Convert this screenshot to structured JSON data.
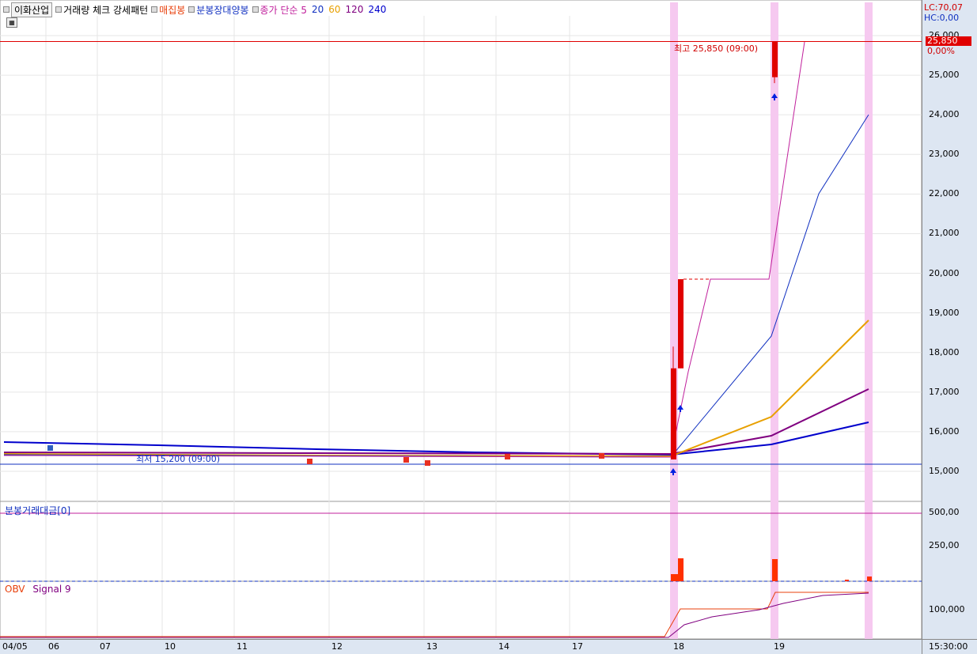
{
  "legend": {
    "stock_name": "이화산업",
    "indicator_1": "거래량 체크 강세패턴",
    "indicator_2": "매집봉",
    "indicator_3": "분봉장대양봉",
    "ma_label": "종가 단순 5",
    "ma_20": "20",
    "ma_60": "60",
    "ma_120": "120",
    "ma_240": "240",
    "colors": {
      "indicator_2": "#e8400c",
      "indicator_3": "#1030c0",
      "ma_5": "#c0209c",
      "ma_20": "#1030c0",
      "ma_60": "#e8a000",
      "ma_120": "#800080",
      "ma_240": "#0000cc"
    }
  },
  "price_axis": {
    "lc": "LC:70,07",
    "hc": "HC:0,00",
    "ticks": [
      "26,000",
      "25,000",
      "24,000",
      "23,000",
      "22,000",
      "21,000",
      "20,000",
      "19,000",
      "18,000",
      "17,000",
      "16,000",
      "15,000"
    ],
    "current_price": "25,850",
    "current_change": "0,00%"
  },
  "annotations": {
    "high": "최고 25,850 (09:00)",
    "low": "최저 15,200 (09:00)"
  },
  "volume_panel": {
    "label": "분봉거래대금[0]",
    "ticks": [
      "500,00",
      "250,00"
    ]
  },
  "obv_panel": {
    "label_obv": "OBV",
    "label_signal": "Signal 9",
    "ticks": [
      "100,000"
    ]
  },
  "date_axis": {
    "dates": [
      "04/05",
      "06",
      "07",
      "10",
      "11",
      "12",
      "13",
      "14",
      "17",
      "18",
      "19"
    ],
    "time": "15:30:00"
  },
  "chart_data": {
    "type": "candlestick",
    "price_range": [
      14600,
      26200
    ],
    "high": 25850,
    "low": 15200,
    "key_levels": {
      "high_line": 25850,
      "low_line": 15200
    },
    "events": [
      {
        "date": "18",
        "open": 15300,
        "close": 17600,
        "high": 18150,
        "low": 15300
      },
      {
        "date": "18",
        "open": 17600,
        "close": 19850,
        "high": 19850,
        "low": 17600
      },
      {
        "date": "19",
        "open": 25850,
        "close": 24950,
        "high": 25850,
        "low": 24800
      }
    ],
    "moving_averages": [
      "5",
      "20",
      "60",
      "120",
      "240"
    ]
  }
}
